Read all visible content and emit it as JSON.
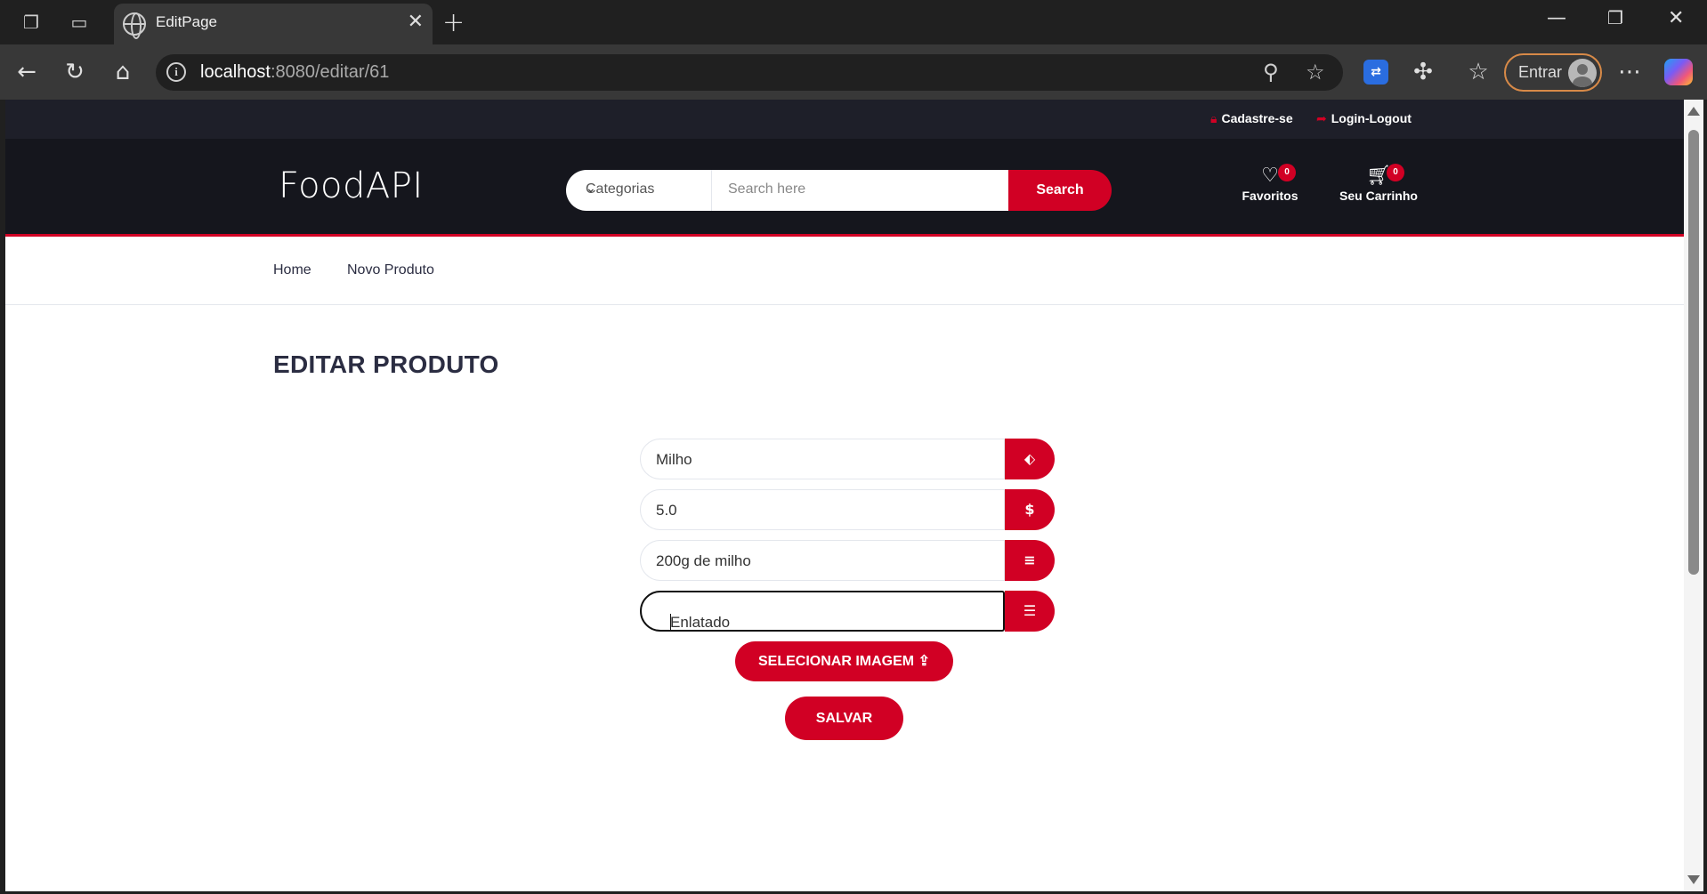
{
  "browser": {
    "tab_title": "EditPage",
    "url_host": "localhost",
    "url_rest": ":8080/editar/61",
    "profile_label": "Entrar"
  },
  "top_header": {
    "register_label": "Cadastre-se",
    "login_label": "Login-Logout"
  },
  "header": {
    "logo": "FoodAPI",
    "category_select": "Categorias",
    "search_placeholder": "Search here",
    "search_button": "Search",
    "favorites_label": "Favoritos",
    "favorites_count": "0",
    "cart_label": "Seu Carrinho",
    "cart_count": "0"
  },
  "nav": {
    "items": [
      {
        "label": "Home"
      },
      {
        "label": "Novo Produto"
      }
    ]
  },
  "page": {
    "title": "EDITAR PRODUTO"
  },
  "form": {
    "name_value": "Milho",
    "price_value": "5.0",
    "description_value": "200g de milho",
    "category_value": "Enlatado",
    "select_image_button": "SELECIONAR IMAGEM",
    "save_button": "SALVAR"
  },
  "colors": {
    "accent": "#d10024",
    "header_dark": "#15161d",
    "top_header": "#1e1f29"
  }
}
